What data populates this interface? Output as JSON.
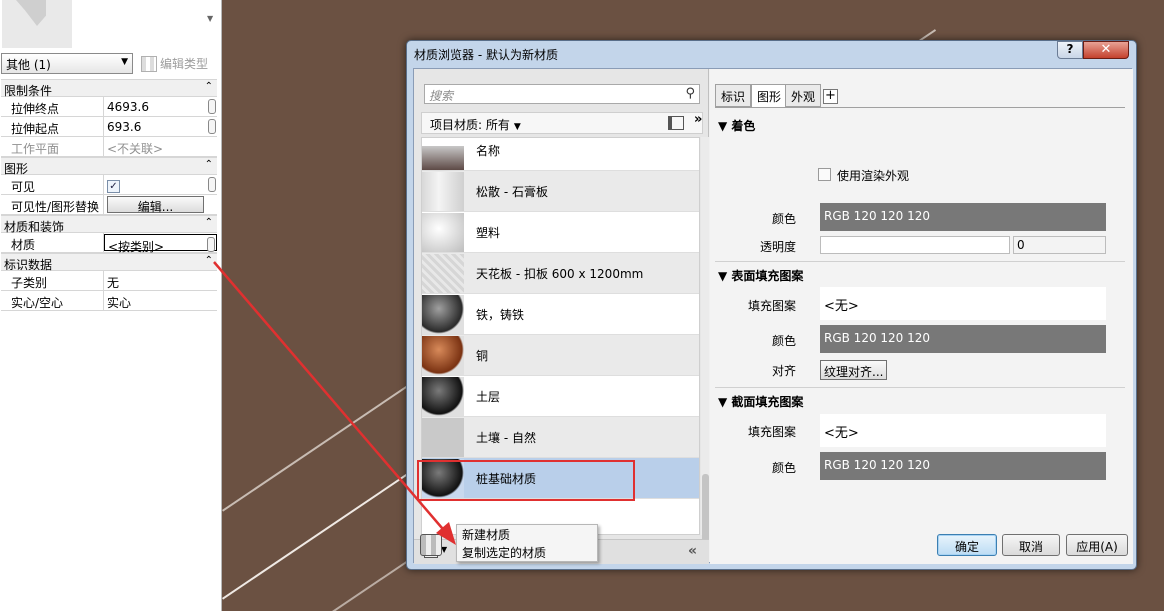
{
  "properties": {
    "type_selector": "其他 (1)",
    "edit_type_label": "编辑类型",
    "sections": [
      {
        "title": "限制条件",
        "rows": [
          {
            "label": "拉伸终点",
            "value": "4693.6"
          },
          {
            "label": "拉伸起点",
            "value": "693.6"
          },
          {
            "label": "工作平面",
            "value": "<不关联>"
          }
        ]
      },
      {
        "title": "图形",
        "rows": [
          {
            "label": "可见",
            "value": "✓"
          },
          {
            "label": "可见性/图形替换",
            "value": "编辑..."
          }
        ]
      },
      {
        "title": "材质和装饰",
        "rows": [
          {
            "label": "材质",
            "value": "<按类别>"
          }
        ]
      },
      {
        "title": "标识数据",
        "rows": [
          {
            "label": "子类别",
            "value": "无"
          },
          {
            "label": "实心/空心",
            "value": "实心"
          }
        ]
      }
    ]
  },
  "dialog": {
    "title": "材质浏览器 - 默认为新材质",
    "help": "?",
    "close": "✕",
    "search_placeholder": "搜索",
    "filter_label": "项目材质: 所有",
    "collapse_left": "»",
    "materials": [
      {
        "name": "名称"
      },
      {
        "name": "松散 - 石膏板"
      },
      {
        "name": "塑料"
      },
      {
        "name": "天花板 - 扣板 600 x 1200mm"
      },
      {
        "name": "铁，铸铁"
      },
      {
        "name": "铜"
      },
      {
        "name": "土层"
      },
      {
        "name": "土壤 - 自然"
      },
      {
        "name": "桩基础材质"
      }
    ],
    "bottom_collapse": "«",
    "menu": {
      "new_material": "新建材质",
      "duplicate_material": "复制选定的材质"
    },
    "tabs": {
      "identity": "标识",
      "graphics": "图形",
      "appearance": "外观",
      "add": "+"
    },
    "shading": {
      "title": "着色",
      "use_render_appearance": "使用渲染外观",
      "color_label": "颜色",
      "color_value": "RGB 120 120 120",
      "transparency_label": "透明度",
      "transparency_value": "0"
    },
    "surface_pattern": {
      "title": "表面填充图案",
      "pattern_label": "填充图案",
      "pattern_value": "<无>",
      "color_label": "颜色",
      "color_value": "RGB 120 120 120",
      "align_label": "对齐",
      "align_button": "纹理对齐..."
    },
    "cut_pattern": {
      "title": "截面填充图案",
      "pattern_label": "填充图案",
      "pattern_value": "<无>",
      "color_label": "颜色",
      "color_value": "RGB 120 120 120"
    },
    "footer": {
      "ok": "确定",
      "cancel": "取消",
      "apply": "应用(A)"
    }
  },
  "colors": {
    "swatch": "#787878",
    "highlight": "#e03030",
    "background_view": "#6b5142"
  }
}
